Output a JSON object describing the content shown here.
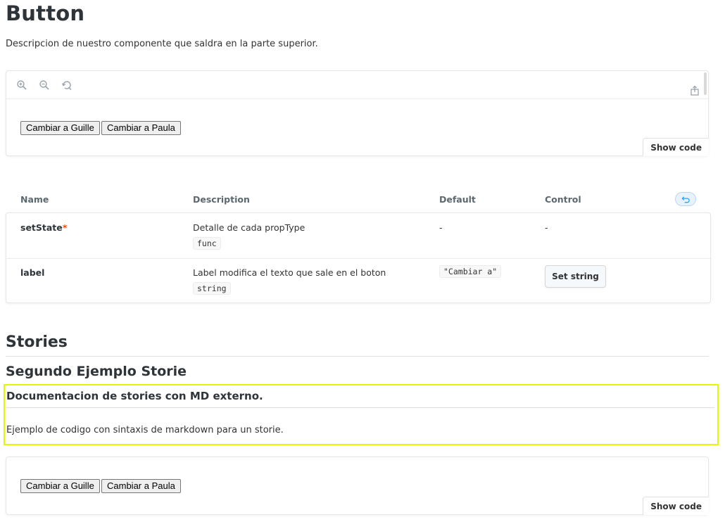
{
  "page": {
    "title": "Button",
    "description": "Descripcion de nuestro componente que saldra en la parte superior."
  },
  "canvas": {
    "toolbar_icons": [
      "zoom-in-icon",
      "zoom-out-icon",
      "zoom-reset-icon",
      "share-icon"
    ],
    "buttons": [
      "Cambiar a Guille",
      "Cambiar a Paula"
    ],
    "show_code_label": "Show code"
  },
  "args_table": {
    "headers": {
      "name": "Name",
      "description": "Description",
      "default": "Default",
      "control": "Control"
    },
    "rows": [
      {
        "name": "setState",
        "required_mark": "*",
        "description": "Detalle de cada propType",
        "type": "func",
        "default": "-",
        "control": "-"
      },
      {
        "name": "label",
        "required_mark": "",
        "description": "Label modifica el texto que sale en el boton",
        "type": "string",
        "default": "\"Cambiar a\"",
        "control": "Set string"
      }
    ]
  },
  "stories": {
    "heading": "Stories",
    "story_title": "Segundo Ejemplo Storie",
    "md_heading": "Documentacion de stories con MD externo.",
    "md_text": "Ejemplo de codigo con sintaxis de markdown para un storie.",
    "buttons": [
      "Cambiar a Guille",
      "Cambiar a Paula"
    ],
    "show_code_label": "Show code"
  },
  "colors": {
    "highlight_border": "#e6f500",
    "required": "#ff4400",
    "reset_accent": "#1ea7fd"
  }
}
